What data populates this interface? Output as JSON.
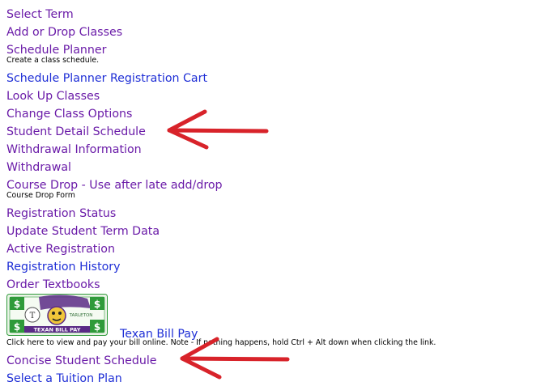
{
  "menu": {
    "select_term": "Select Term",
    "add_drop": "Add or Drop Classes",
    "schedule_planner": "Schedule Planner",
    "schedule_planner_desc": "Create a class schedule.",
    "planner_cart": "Schedule Planner Registration Cart",
    "lookup_classes": "Look Up Classes",
    "change_options": "Change Class Options",
    "detail_schedule": "Student Detail Schedule",
    "withdrawal_info": "Withdrawal Information",
    "withdrawal": "Withdrawal",
    "course_drop": "Course Drop - Use after late add/drop",
    "course_drop_desc": "Course Drop Form",
    "registration_status": "Registration Status",
    "update_term_data": "Update Student Term Data",
    "active_registration": "Active Registration",
    "registration_history": "Registration History",
    "order_textbooks": "Order Textbooks",
    "texan_bill_pay": "Texan Bill Pay",
    "texan_bill_pay_desc": "Click here to view and pay your bill online.  Note - If nothing happens, hold Ctrl + Alt down when clicking the link.",
    "concise_schedule": "Concise Student Schedule",
    "tuition_plan": "Select a Tuition Plan"
  },
  "bill_image": {
    "top_text": "TARLETON",
    "bottom_text": "TEXAN BILL PAY",
    "dollar_sign": "$"
  },
  "colors": {
    "visited_link": "#6a1ba8",
    "unvisited_link": "#1f2fd6",
    "annotation_arrow": "#d8232a",
    "bill_green": "#2f9a3a",
    "bill_purple": "#5a2a86"
  }
}
